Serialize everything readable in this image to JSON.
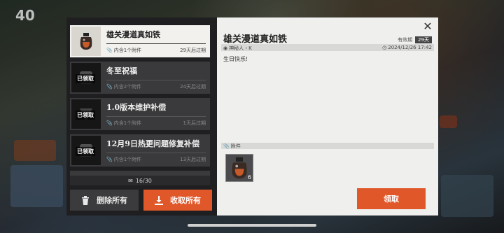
{
  "mail_list": {
    "items": [
      {
        "title": "雄关漫道真如铁",
        "attachments": "内含1个附件",
        "expire": "29天后过期",
        "claimed": false,
        "active": true
      },
      {
        "title": "冬至祝福",
        "attachments": "内含2个附件",
        "expire": "24天后过期",
        "claimed": true,
        "active": false
      },
      {
        "title": "1.0版本维护补偿",
        "attachments": "内含1个附件",
        "expire": "1天后过期",
        "claimed": true,
        "active": false
      },
      {
        "title": "12月9日热更问题修复补偿",
        "attachments": "内含1个附件",
        "expire": "13天后过期",
        "claimed": true,
        "active": false
      }
    ],
    "claimed_label": "已领取",
    "counter": "16/30"
  },
  "actions": {
    "delete_all": "删除所有",
    "collect_all": "收取所有"
  },
  "detail": {
    "title": "雄关漫道真如铁",
    "validity_label": "有效期",
    "validity_value": "29天",
    "sender": "神秘人・K",
    "datetime": "2024/12/26 17:42",
    "body": "生日快乐!",
    "attachments_label": "附件",
    "attachment_count": "6",
    "claim_label": "领取"
  },
  "hud": {
    "level": "40"
  },
  "colors": {
    "accent": "#e0582a",
    "panel_dark": "#1f1f21",
    "panel_light": "#efefee"
  }
}
